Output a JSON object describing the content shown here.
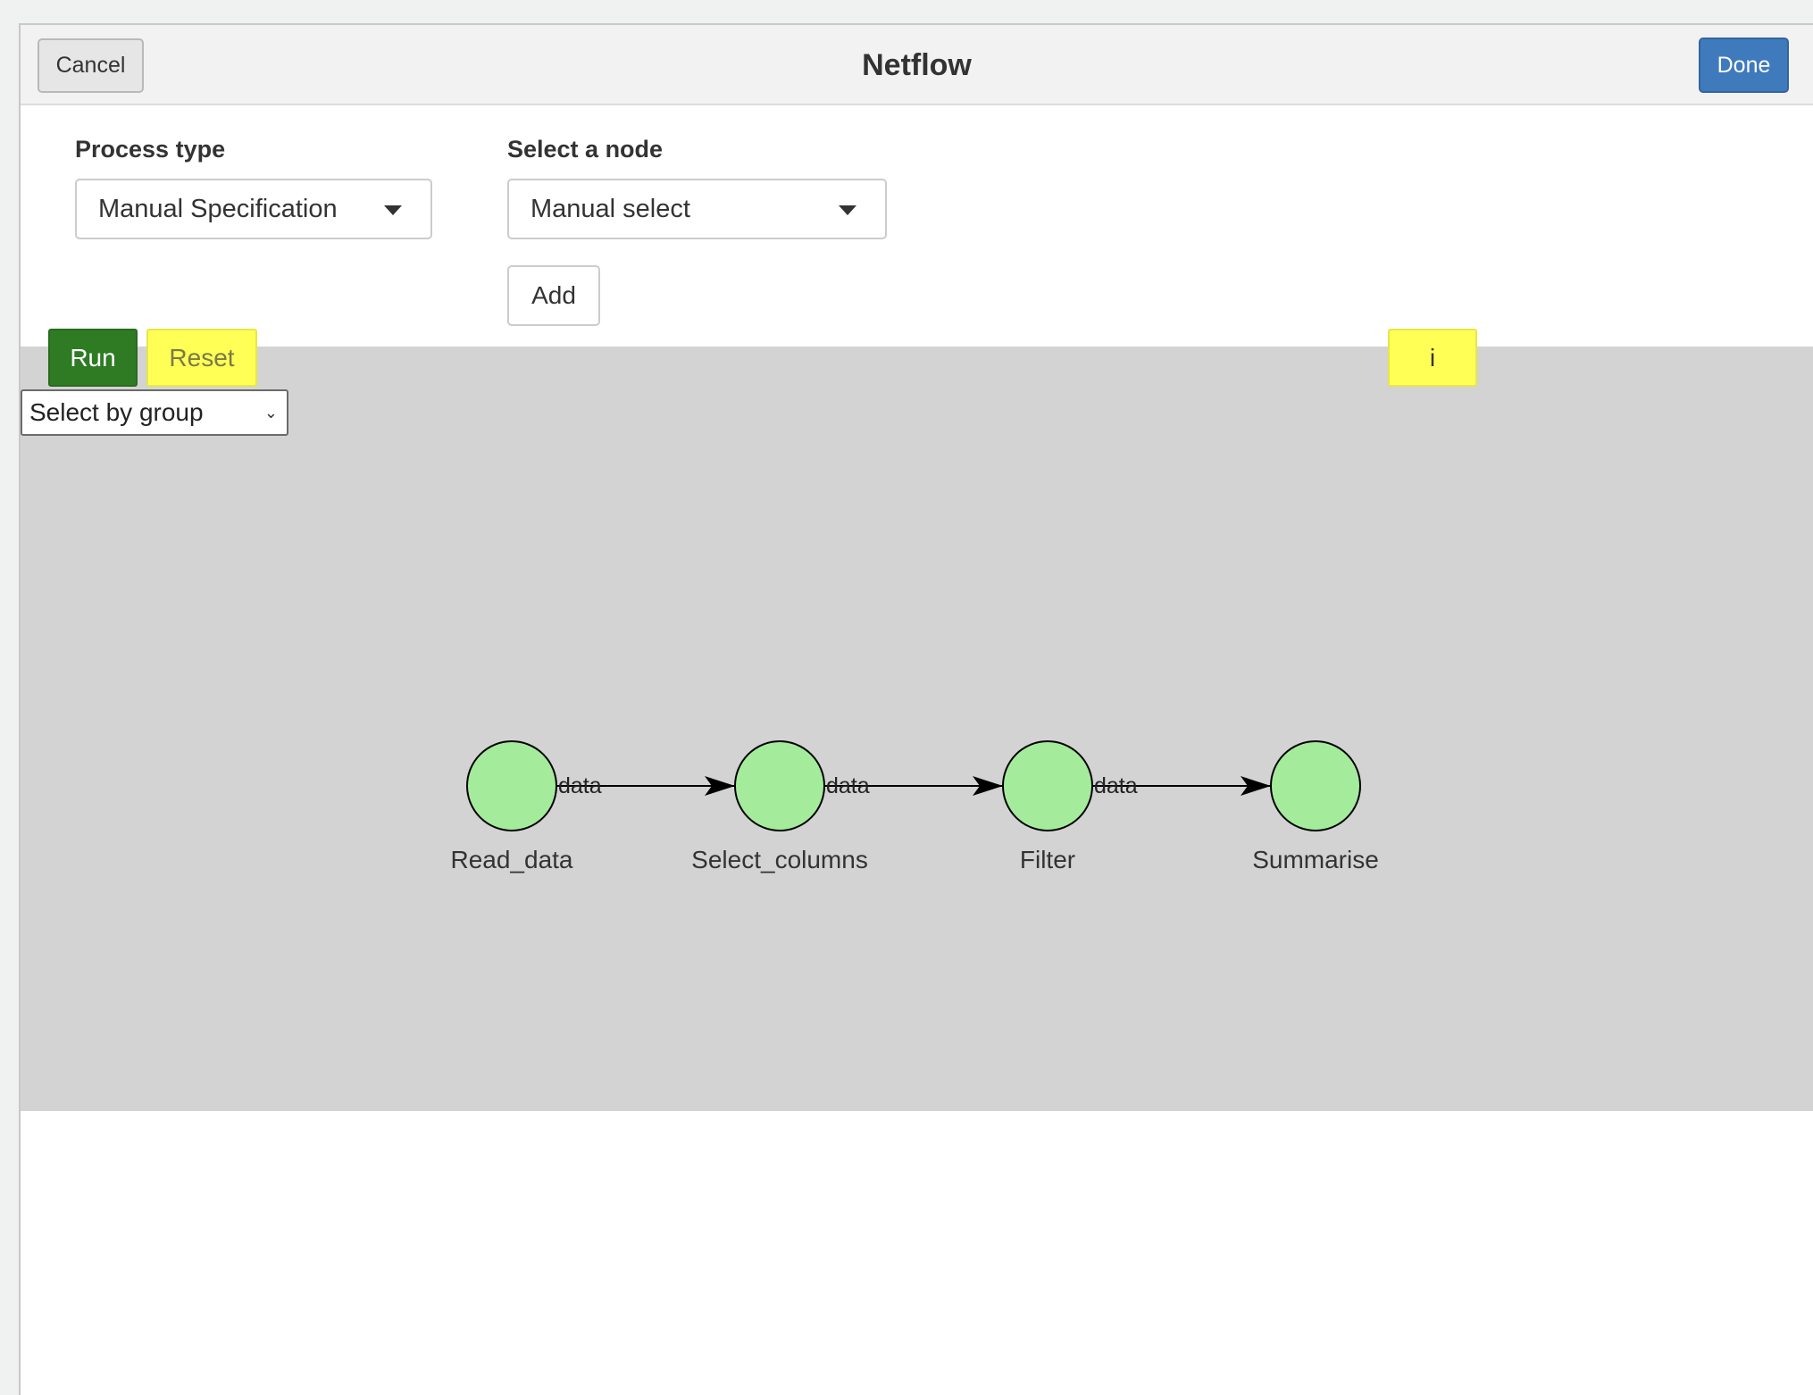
{
  "header": {
    "title": "Netflow",
    "cancel_label": "Cancel",
    "done_label": "Done"
  },
  "form": {
    "process_type": {
      "label": "Process type",
      "selected": "Manual Specification"
    },
    "node_select": {
      "label": "Select a node",
      "selected": "Manual select"
    },
    "add_label": "Add"
  },
  "toolbar": {
    "run_label": "Run",
    "reset_label": "Reset",
    "info_label": "i",
    "group_select": "Select by group"
  },
  "colors": {
    "node_fill": "#a4ec9c",
    "canvas_bg": "#d3d3d3",
    "run_green": "#2e7b24",
    "reset_yellow": "#ffff55",
    "done_blue": "#3f7abd"
  },
  "graph": {
    "nodes": [
      {
        "id": "Read_data",
        "label": "Read_data"
      },
      {
        "id": "Select_columns",
        "label": "Select_columns"
      },
      {
        "id": "Filter",
        "label": "Filter"
      },
      {
        "id": "Summarise",
        "label": "Summarise"
      }
    ],
    "edges": [
      {
        "from": "Read_data",
        "to": "Select_columns",
        "label": "data"
      },
      {
        "from": "Select_columns",
        "to": "Filter",
        "label": "data"
      },
      {
        "from": "Filter",
        "to": "Summarise",
        "label": "data"
      }
    ]
  }
}
